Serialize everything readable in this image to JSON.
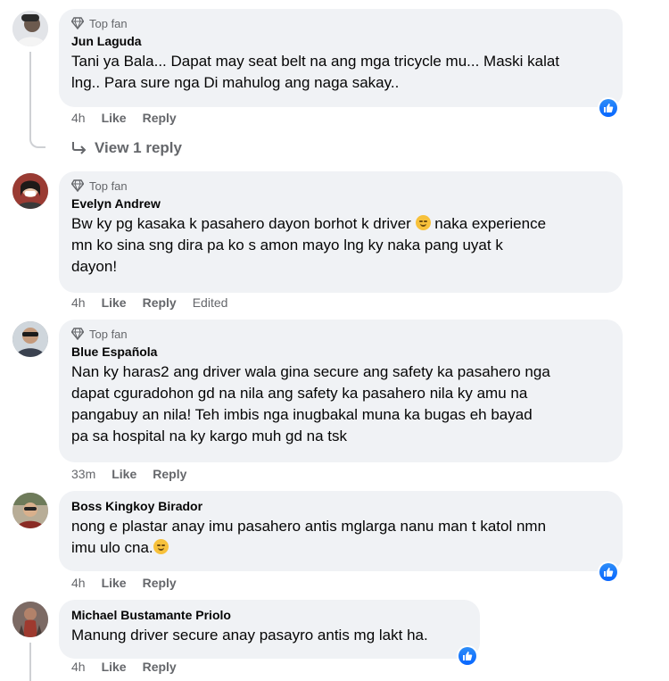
{
  "colors": {
    "bubble": "#f0f2f5",
    "meta": "#65676b",
    "text": "#050505",
    "like_blue": "#0866ff"
  },
  "comments": [
    {
      "badge": "Top fan",
      "author": "Jun Laguda",
      "lines": [
        "Tani ya Bala... Dapat may seat belt na ang mga tricycle mu... Maski kalat",
        "lng.. Para sure nga Di mahulog ang naga sakay.."
      ],
      "time": "4h",
      "like": "Like",
      "reply": "Reply",
      "view_replies": "View 1 reply",
      "reaction_icon": "like-icon"
    },
    {
      "badge": "Top fan",
      "author": "Evelyn Andrew",
      "lines": [
        "Bw ky pg kasaka k pasahero dayon borhot k driver",
        "naka experience",
        "mn ko sina sng dira pa ko s amon mayo lng ky naka pang uyat k",
        "dayon!"
      ],
      "time": "4h",
      "like": "Like",
      "reply": "Reply",
      "edited": "Edited"
    },
    {
      "badge": "Top fan",
      "author": "Blue Española",
      "lines": [
        "Nan ky haras2 ang driver wala gina secure ang safety ka pasahero nga",
        "dapat cguradohon gd na nila ang safety ka pasahero nila ky amu na",
        "pangabuy an nila! Teh imbis nga inugbakal muna ka bugas eh bayad",
        "pa sa hospital na ky kargo muh gd na tsk"
      ],
      "time": "33m",
      "like": "Like",
      "reply": "Reply"
    },
    {
      "author": "Boss Kingkoy Birador",
      "lines": [
        "nong e plastar anay imu pasahero antis mglarga nanu man t katol nmn",
        "imu ulo cna."
      ],
      "time": "4h",
      "like": "Like",
      "reply": "Reply",
      "reaction_icon": "like-icon"
    },
    {
      "author": "Michael Bustamante Priolo",
      "lines": [
        "Manung driver secure anay pasayro antis mg lakt ha."
      ],
      "time": "4h",
      "like": "Like",
      "reply": "Reply",
      "reaction_icon": "like-icon"
    }
  ]
}
